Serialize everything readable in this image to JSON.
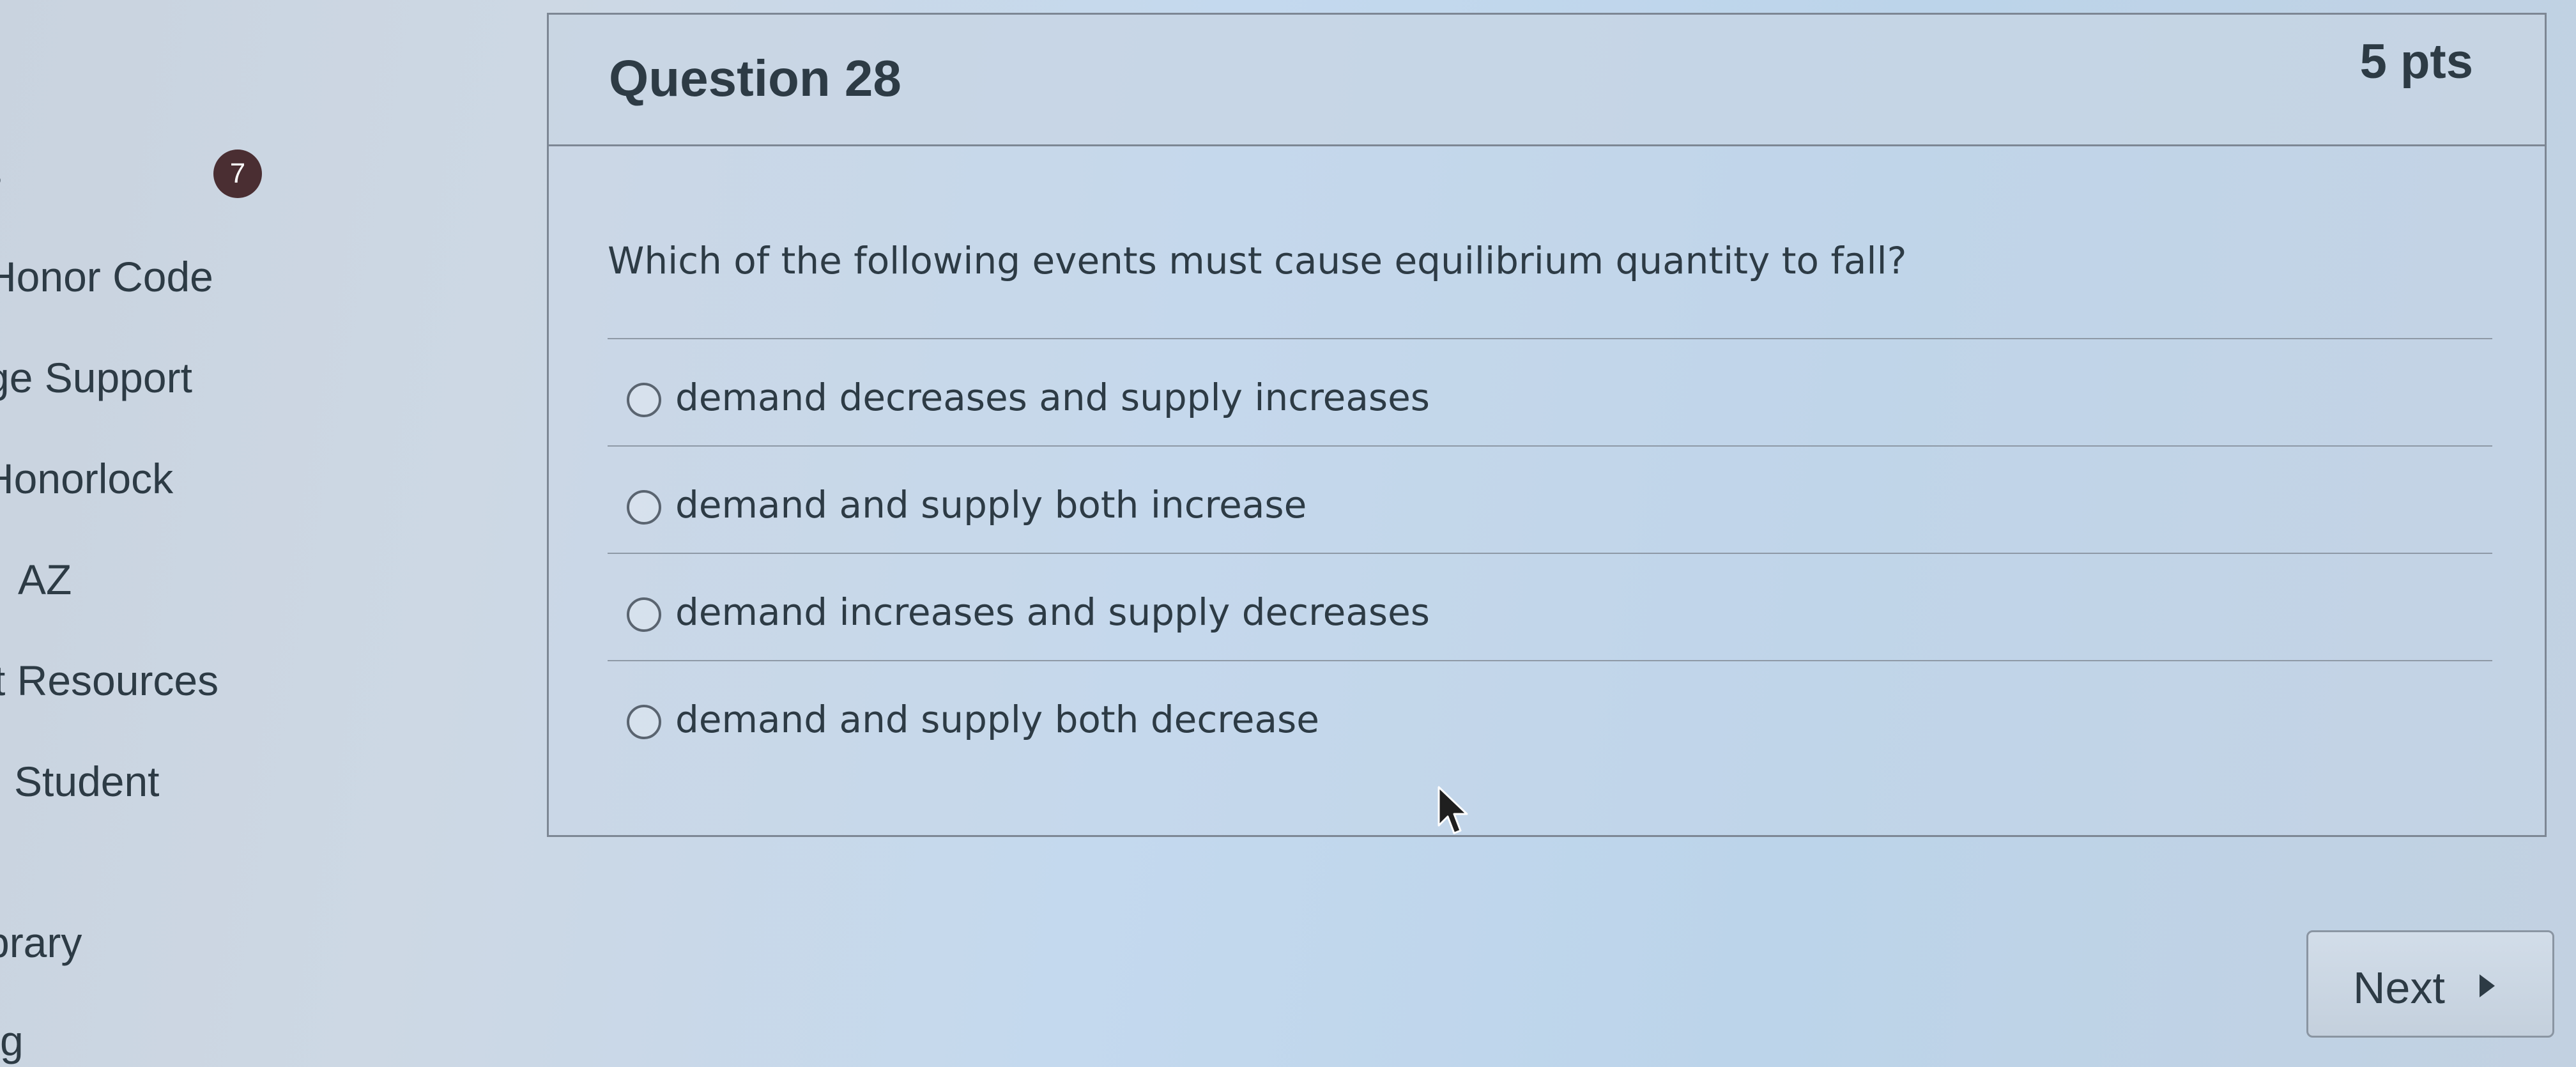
{
  "sidebar": {
    "badge": "7",
    "items": [
      {
        "label": "s"
      },
      {
        "label": "Honor Code"
      },
      {
        "label": "ge Support"
      },
      {
        "label": "Honorlock"
      },
      {
        "label": "AZ"
      },
      {
        "label": "t Resources"
      },
      {
        "label": "Student"
      },
      {
        "label": "brary"
      },
      {
        "label": "g"
      }
    ]
  },
  "question": {
    "title": "Question 28",
    "points": "5 pts",
    "text": "Which of the following events must cause equilibrium quantity to fall?",
    "answers": [
      {
        "label": "demand decreases and supply increases",
        "selected": false
      },
      {
        "label": "demand and supply both increase",
        "selected": false
      },
      {
        "label": "demand increases and supply decreases",
        "selected": false
      },
      {
        "label": "demand and supply both decrease",
        "selected": false
      }
    ]
  },
  "navigation": {
    "next_label": "Next",
    "next_icon": "caret-right-icon"
  },
  "colors": {
    "text": "#2d3b45",
    "badge": "#4a2e32",
    "border": "#7d8794"
  }
}
